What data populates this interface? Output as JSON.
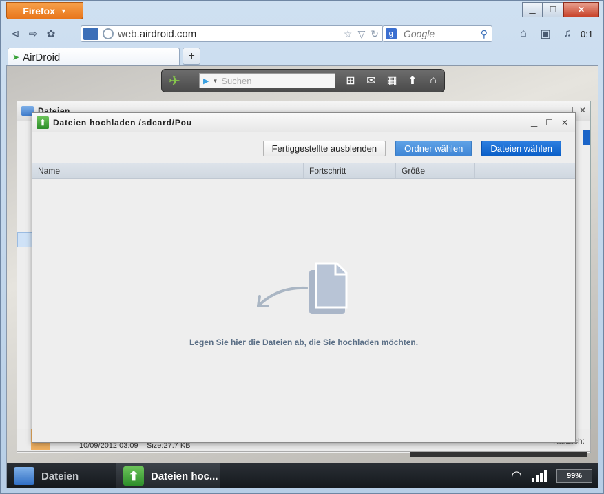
{
  "firefox": {
    "menu_label": "Firefox",
    "url_prefix": "web.",
    "url_domain": "airdroid.com",
    "search_placeholder": "Google",
    "clock": "0:1",
    "tab_title": "AirDroid",
    "newtab_label": "+"
  },
  "airdroid": {
    "search_placeholder": "Suchen",
    "bg_window_title": "Dateien",
    "bg_file_date": "10/09/2012 03:09",
    "bg_file_size": "Size:27.7 KB",
    "bg_right_text": "Kürzlich:",
    "dialog": {
      "title": "Dateien hochladen /sdcard/Pou",
      "buttons": {
        "hide_finished": "Fertiggestellte ausblenden",
        "choose_folder": "Ordner wählen",
        "choose_files": "Dateien wählen"
      },
      "columns": [
        "Name",
        "Fortschritt",
        "Größe"
      ],
      "drop_text": "Legen Sie hier die Dateien ab, die Sie hochladen möchten."
    },
    "taskbar": {
      "task1": "Dateien",
      "task2": "Dateien hoc...",
      "battery": "99%"
    }
  },
  "colors": {
    "accent": "#0a5fc8",
    "firefox_orange": "#e8761b",
    "airdroid_green": "#86c74b"
  }
}
